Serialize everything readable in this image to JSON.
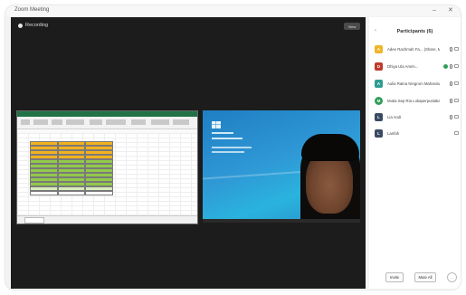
{
  "window": {
    "app_title": "Zoom Meeting",
    "controls": [
      "–",
      "✕"
    ]
  },
  "stage": {
    "recording_label": "Recording",
    "view_button_label": "View"
  },
  "excel_tile": {
    "sheet_title": "",
    "accent_color": "#217346"
  },
  "participants_panel": {
    "title": "Participants (6)",
    "items": [
      {
        "initial": "A",
        "name": "Adee Rachmah Fa... (Share, Me)",
        "color": "#f0b429"
      },
      {
        "initial": "D",
        "name": "Dhiya Ula Amrin...",
        "color": "#c0392b"
      },
      {
        "initial": "A",
        "name": "Aulia Ratna Ningrum Mahasiswa...",
        "color": "#2e9c8f"
      },
      {
        "initial": "M",
        "name": "Mutia Sep Ria Lokaperpustakaan",
        "color": "#2f9e5b"
      },
      {
        "initial": "L",
        "name": "Lia Andi",
        "color": "#3b4a63"
      },
      {
        "initial": "L",
        "name": "Lanfah",
        "color": "#3b4a63"
      }
    ],
    "invite_label": "Invite",
    "mute_all_label": "Mute All",
    "more_label": "..."
  }
}
